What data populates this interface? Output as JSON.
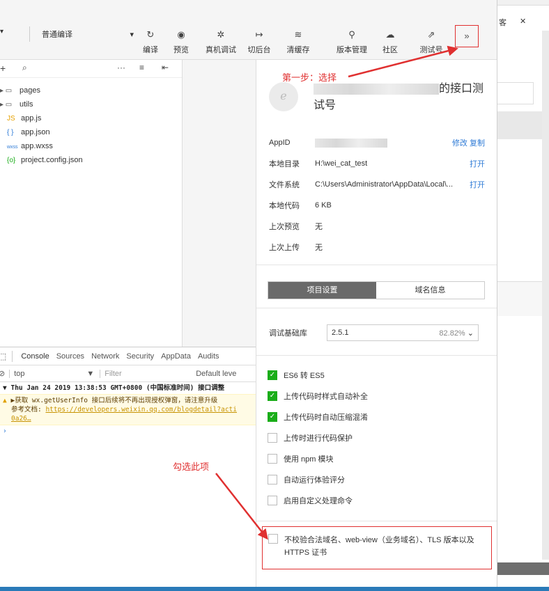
{
  "toolbar": {
    "compile_mode": "普通编译",
    "buttons": [
      {
        "icon": "refresh-icon",
        "glyph": "↻",
        "label": "编译"
      },
      {
        "icon": "eye-icon",
        "glyph": "◉",
        "label": "预览"
      },
      {
        "icon": "bug-icon",
        "glyph": "✲",
        "label": "真机调试"
      },
      {
        "icon": "switch-icon",
        "glyph": "↦",
        "label": "切后台"
      },
      {
        "icon": "clear-cache-icon",
        "glyph": "≋",
        "label": "清缓存"
      },
      {
        "icon": "branch-icon",
        "glyph": "⚲",
        "label": "版本管理"
      },
      {
        "icon": "community-icon",
        "glyph": "☁",
        "label": "社区"
      },
      {
        "icon": "external-icon",
        "glyph": "⇗",
        "label": "测试号"
      }
    ],
    "more": "»"
  },
  "file_tree": {
    "items": [
      {
        "type": "folder",
        "name": "pages"
      },
      {
        "type": "folder",
        "name": "utils"
      },
      {
        "type": "js",
        "name": "app.js"
      },
      {
        "type": "json",
        "name": "app.json"
      },
      {
        "type": "wxss",
        "name": "app.wxss"
      },
      {
        "type": "config",
        "name": "project.config.json"
      }
    ]
  },
  "devtools": {
    "tabs": [
      "Console",
      "Sources",
      "Network",
      "Security",
      "AppData",
      "Audits"
    ],
    "context": "top",
    "filter_placeholder": "Filter",
    "level": "Default leve",
    "log_header": "Thu Jan 24 2019 13:38:53 GMT+0800 (中国标准时间) 接口调整",
    "warn_line1": "▶获取 wx.getUserInfo 接口后续将不再出现授权弹窗，请注意升级",
    "warn_line2_prefix": "参考文档: ",
    "warn_link": "https://developers.weixin.qq.com/blogdetail?acti",
    "warn_line3": "0a26…"
  },
  "project": {
    "name_suffix": "的接口测",
    "name_line2": "试号",
    "rows": [
      {
        "key": "AppID",
        "value": "",
        "actions": "修改  复制"
      },
      {
        "key": "本地目录",
        "value": "H:\\wei_cat_test",
        "actions": "打开"
      },
      {
        "key": "文件系统",
        "value": "C:\\Users\\Administrator\\AppData\\Local\\...",
        "actions": "打开"
      },
      {
        "key": "本地代码",
        "value": "6 KB",
        "actions": ""
      },
      {
        "key": "上次预览",
        "value": "无",
        "actions": ""
      },
      {
        "key": "上次上传",
        "value": "无",
        "actions": ""
      }
    ],
    "seg_tabs": [
      "项目设置",
      "域名信息"
    ],
    "lib_label": "调试基础库",
    "lib_version": "2.5.1",
    "lib_percent": "82.82%",
    "options": [
      {
        "label": "ES6 转 ES5",
        "checked": true
      },
      {
        "label": "上传代码时样式自动补全",
        "checked": true
      },
      {
        "label": "上传代码时自动压缩混淆",
        "checked": true
      },
      {
        "label": "上传时进行代码保护",
        "checked": false
      },
      {
        "label": "使用 npm 模块",
        "checked": false
      },
      {
        "label": "自动运行体验评分",
        "checked": false
      },
      {
        "label": "启用自定义处理命令",
        "checked": false
      }
    ],
    "special_option": "不校验合法域名、web-view（业务域名）、TLS 版本以及 HTTPS 证书"
  },
  "annotations": {
    "step1": "第一步：选择",
    "check_this": "勾选此项"
  },
  "right_window": {
    "tab_text": "客",
    "close": "✕"
  },
  "colors": {
    "accent_red": "#e03030",
    "check_green": "#1aad19",
    "link_blue": "#2d7ad6"
  }
}
